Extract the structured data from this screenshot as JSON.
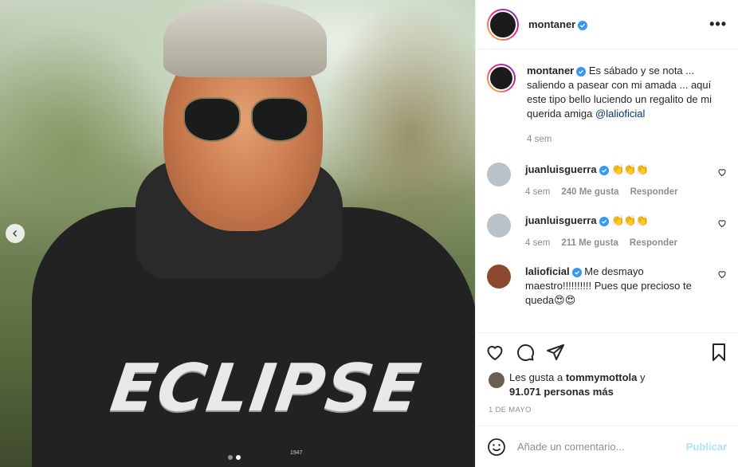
{
  "post": {
    "author": "montaner",
    "more_icon": "more-horizontal-icon",
    "caption": "Es sábado y se nota ... saliendo a pasear con mi amada ... aquí este tipo bello luciendo un regalito de mi querida amiga",
    "caption_mention": "@lalioficial",
    "caption_time": "4 sem",
    "image_text": {
      "shirt": "ECLIPSE",
      "year": "1947"
    },
    "carousel": {
      "count": 2,
      "active": 2
    }
  },
  "comments": [
    {
      "user": "juanluisguerra",
      "text": "👏👏👏",
      "time": "4 sem",
      "likes": "240 Me gusta",
      "reply": "Responder"
    },
    {
      "user": "juanluisguerra",
      "text": "👏👏👏",
      "time": "4 sem",
      "likes": "211 Me gusta",
      "reply": "Responder"
    },
    {
      "user": "lalioficial",
      "text": "Me desmayo maestro!!!!!!!!!! Pues que precioso te queda😍😍"
    }
  ],
  "likes": {
    "prefix": "Les gusta a",
    "user": "tommymottola",
    "connector": "y",
    "others": "91.071 personas más"
  },
  "date": "1 DE MAYO",
  "composer": {
    "placeholder": "Añade un comentario...",
    "publish": "Publicar"
  },
  "colors": {
    "verified": "#3897f0",
    "publish": "#b2dffc",
    "mention": "#00376b"
  }
}
